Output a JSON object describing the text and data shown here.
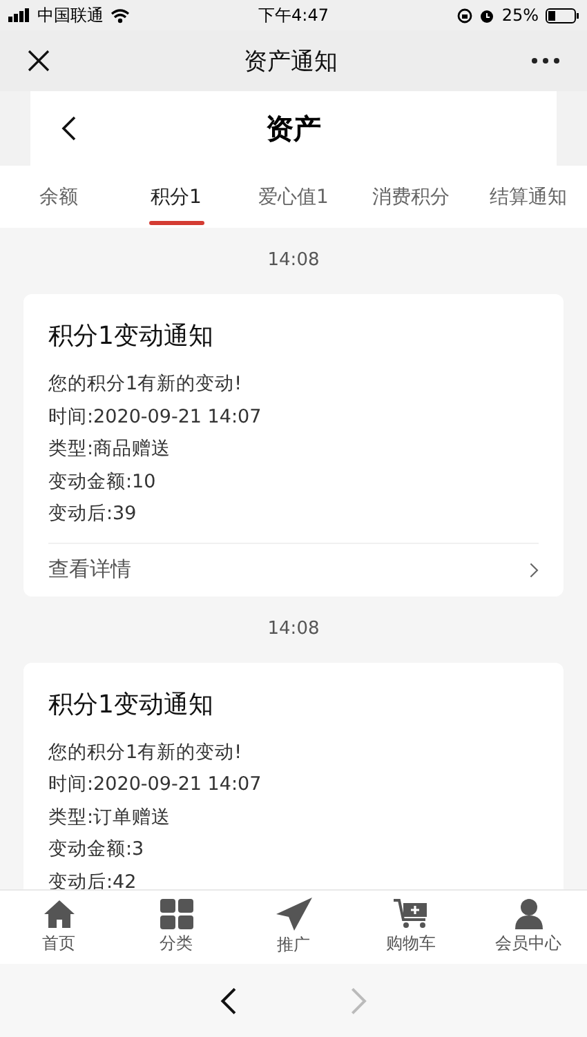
{
  "status_bar": {
    "carrier": "中国联通",
    "time": "下午4:47",
    "battery": "25%"
  },
  "wechat_bar": {
    "title": "资产通知"
  },
  "header": {
    "title": "资产"
  },
  "tabs": [
    {
      "label": "余额",
      "selected": false
    },
    {
      "label": "积分1",
      "selected": true
    },
    {
      "label": "爱心值1",
      "selected": false
    },
    {
      "label": "消费积分",
      "selected": false
    },
    {
      "label": "结算通知",
      "selected": false
    }
  ],
  "messages": [
    {
      "time": "14:08",
      "title": "积分1变动通知",
      "lines": [
        "您的积分1有新的变动!",
        "时间:2020-09-21 14:07",
        "类型:商品赠送",
        "变动金额:10",
        "变动后:39"
      ],
      "link": "查看详情"
    },
    {
      "time": "14:08",
      "title": "积分1变动通知",
      "lines": [
        "您的积分1有新的变动!",
        "时间:2020-09-21 14:07",
        "类型:订单赠送",
        "变动金额:3",
        "变动后:42"
      ]
    }
  ],
  "tab_bar": [
    {
      "kind": "home",
      "label": "首页"
    },
    {
      "kind": "grid",
      "label": "分类"
    },
    {
      "kind": "plane",
      "label": "推广"
    },
    {
      "kind": "cart",
      "label": "购物车"
    },
    {
      "kind": "user",
      "label": "会员中心"
    }
  ],
  "browser_bar": {
    "back_disabled": false,
    "forward_disabled": true
  }
}
